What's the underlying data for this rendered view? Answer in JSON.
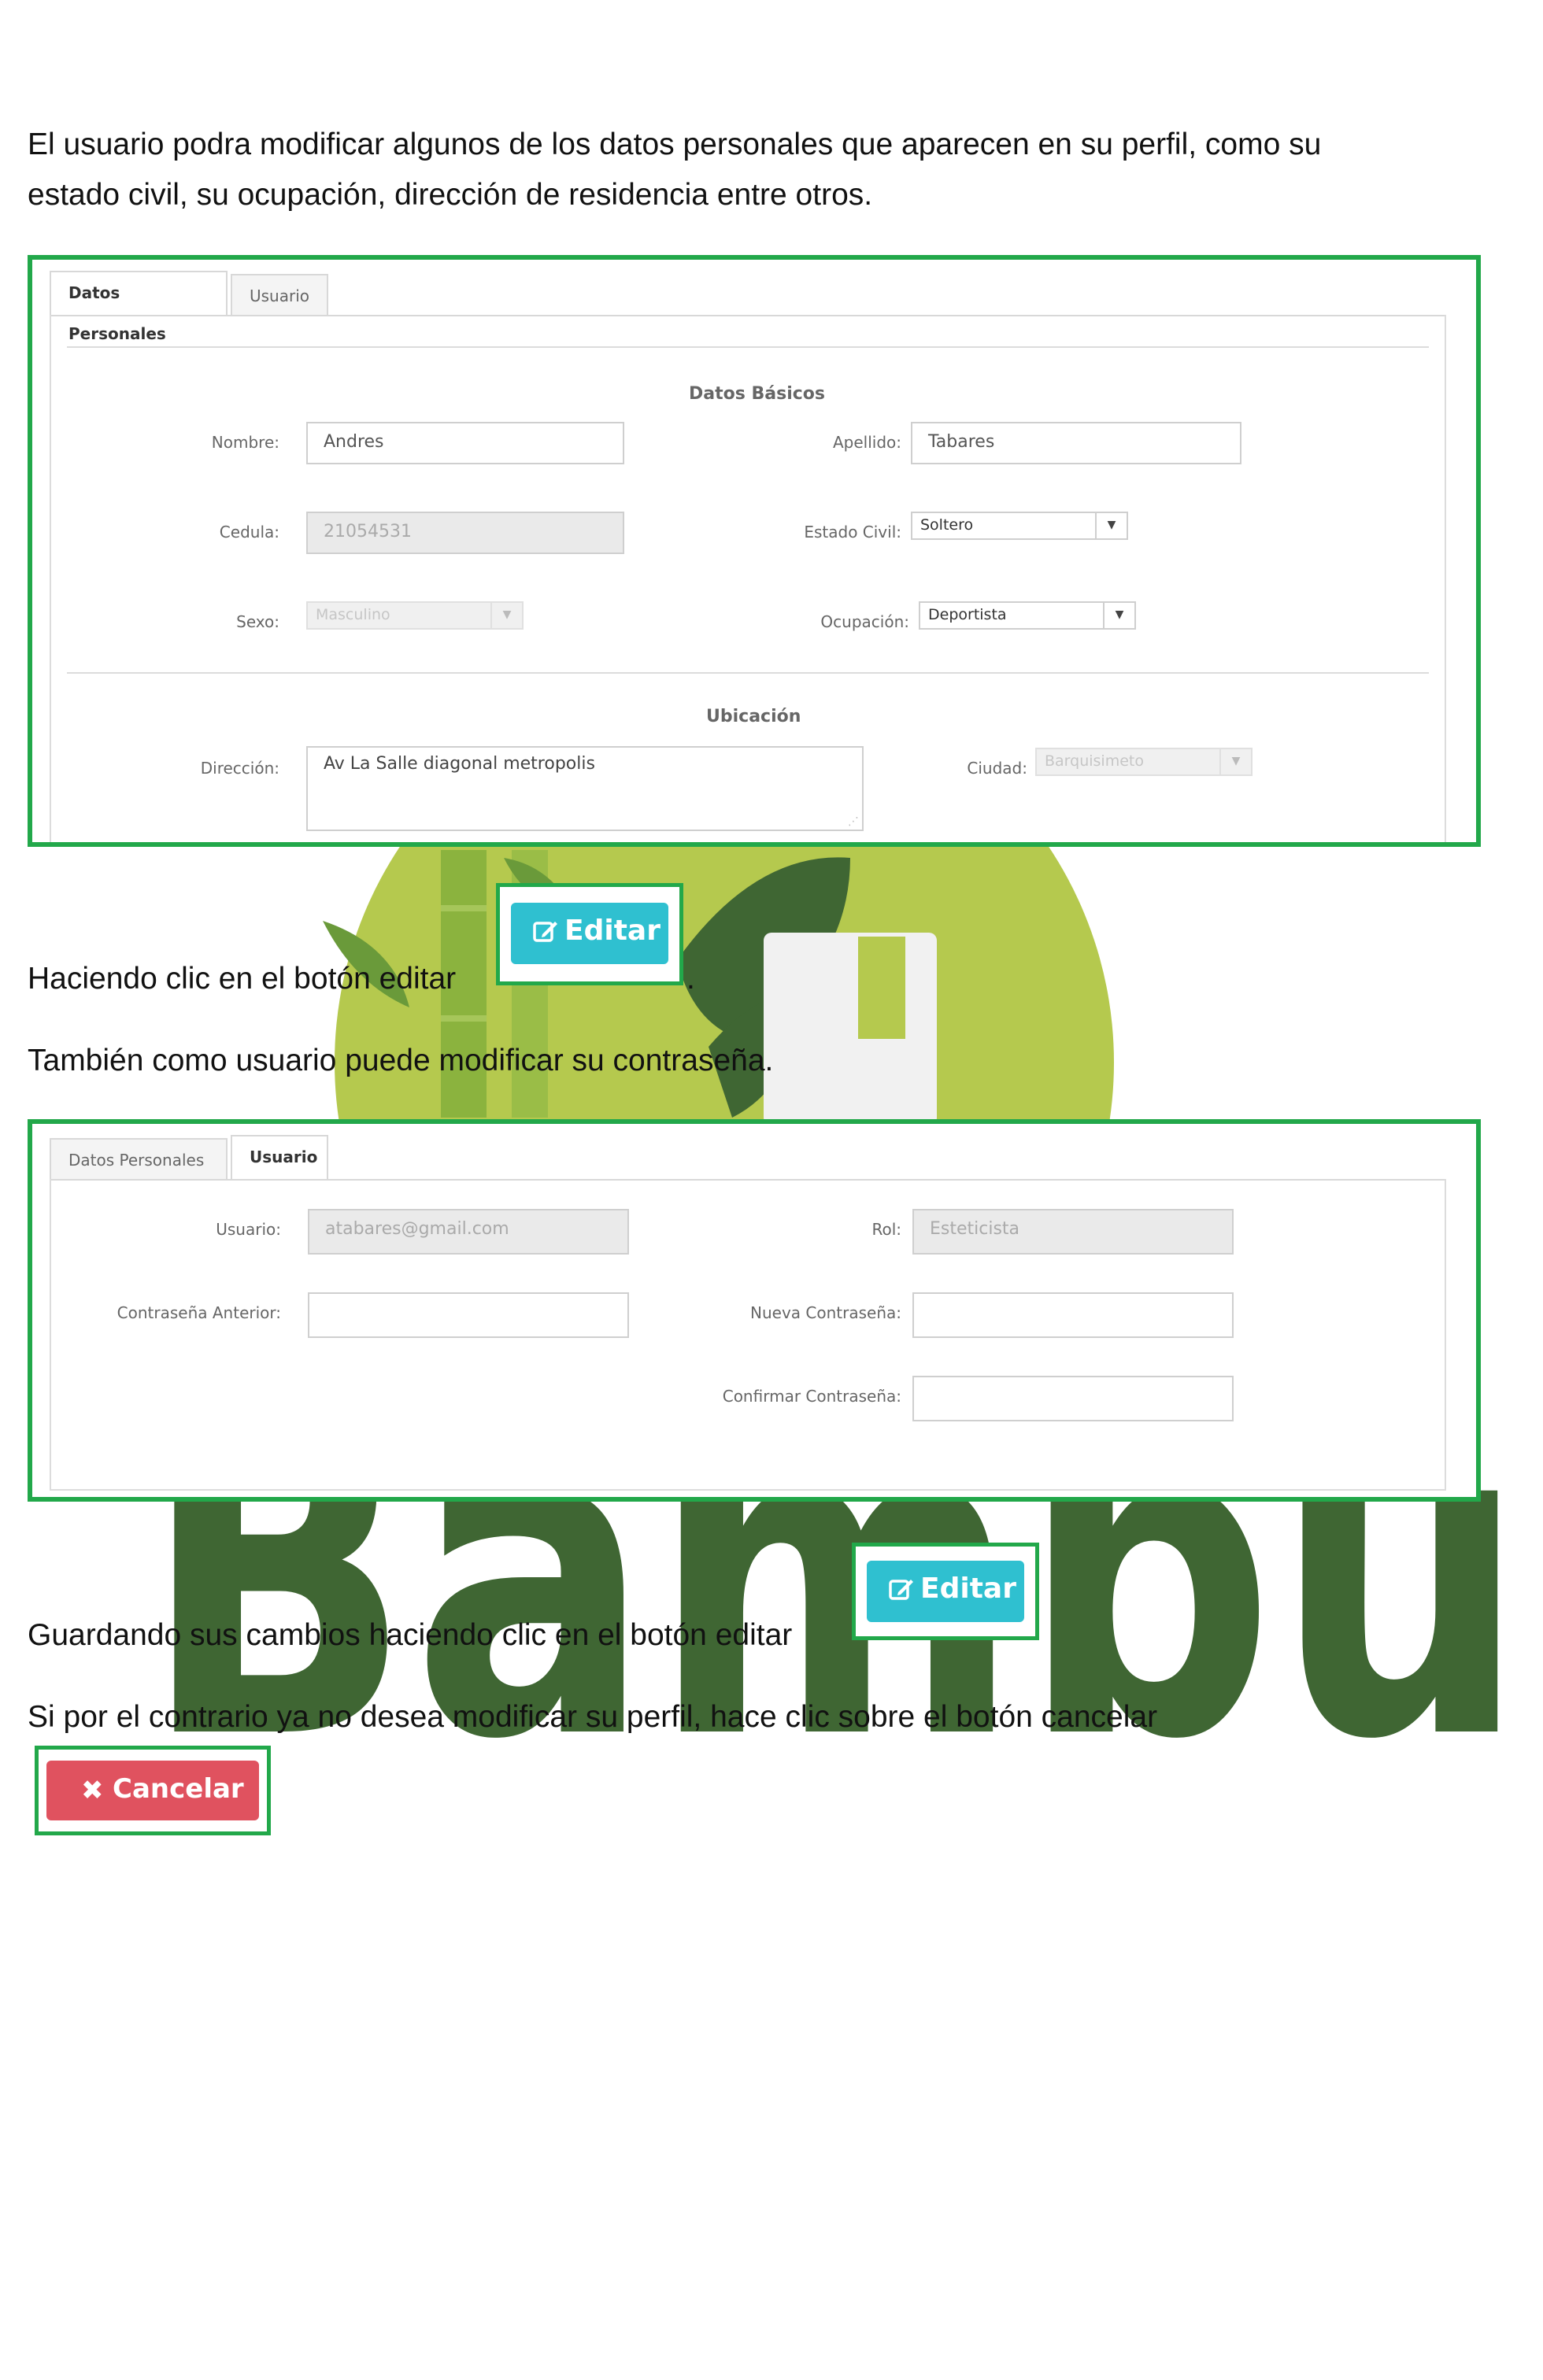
{
  "watermark": {
    "word": "Bambu",
    "letter": "B",
    "colors": {
      "lime": "#b5c94e",
      "dark_green": "#3f6633",
      "bamboo": "#8bb33e"
    }
  },
  "paragraphs": {
    "intro_line1": "El usuario podra modificar algunos de los datos personales que aparecen en su perfil, como su",
    "intro_line2": "estado civil, su ocupación, dirección de residencia entre otros.",
    "edit_instruction": "Haciendo clic en el botón editar",
    "edit_instruction_end": ".",
    "password_intro": "También como usuario puede modificar su contraseña.",
    "save_instruction": "Guardando sus cambios haciendo clic en el botón editar",
    "cancel_instruction": "Si por el contrario ya no desea modificar su perfil, hace clic sobre el botón cancelar"
  },
  "form1": {
    "tabs": {
      "personal": "Datos Personales",
      "user": "Usuario"
    },
    "active_tab": "personal",
    "basic_title": "Datos Básicos",
    "location_title": "Ubicación",
    "fields": {
      "nombre": {
        "label": "Nombre:",
        "value": "Andres"
      },
      "apellido": {
        "label": "Apellido:",
        "value": "Tabares"
      },
      "cedula": {
        "label": "Cedula:",
        "value": "21054531"
      },
      "estado_civil": {
        "label": "Estado Civil:",
        "value": "Soltero"
      },
      "sexo": {
        "label": "Sexo:",
        "value": "Masculino"
      },
      "ocupacion": {
        "label": "Ocupación:",
        "value": "Deportista"
      },
      "direccion": {
        "label": "Dirección:",
        "value": "Av La Salle diagonal metropolis"
      },
      "ciudad": {
        "label": "Ciudad:",
        "value": "Barquisimeto"
      }
    }
  },
  "form2": {
    "tabs": {
      "personal": "Datos Personales",
      "user": "Usuario"
    },
    "active_tab": "user",
    "fields": {
      "usuario": {
        "label": "Usuario:",
        "value": "atabares@gmail.com"
      },
      "rol": {
        "label": "Rol:",
        "value": "Esteticista"
      },
      "contrasena_anterior": {
        "label": "Contraseña Anterior:",
        "value": ""
      },
      "nueva_contrasena": {
        "label": "Nueva Contraseña:",
        "value": ""
      },
      "confirmar_contrasena": {
        "label": "Confirmar Contraseña:",
        "value": ""
      }
    }
  },
  "buttons": {
    "edit_label": "Editar",
    "edit_icon": "edit-icon",
    "cancel_label": "Cancelar",
    "cancel_icon": "x-icon",
    "colors": {
      "edit": "#2fc0d0",
      "cancel": "#e0525f",
      "highlight_border": "#22a84a"
    }
  }
}
